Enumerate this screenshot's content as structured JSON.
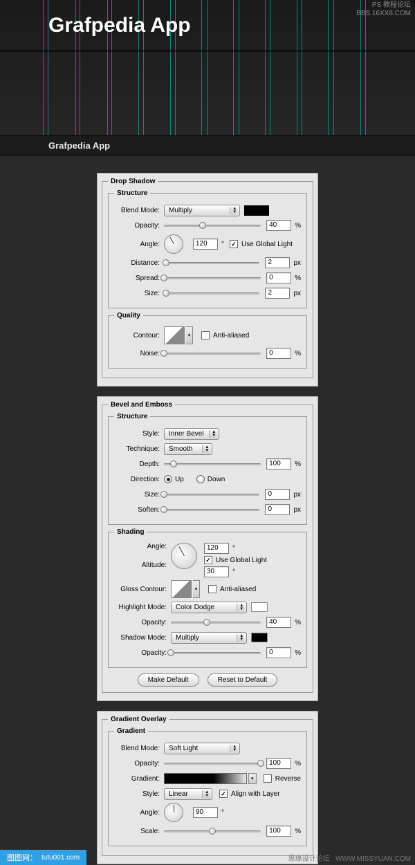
{
  "watermark": {
    "line1": "PS 教程论坛",
    "line2": "BBS.16XX8.COM"
  },
  "app_title": "Grafpedia App",
  "sub_title": "Grafpedia App",
  "guides": [
    62,
    69,
    109,
    115,
    155,
    161,
    200,
    207,
    246,
    253,
    291,
    299,
    337,
    345,
    383,
    390,
    429,
    436,
    474,
    482,
    521,
    528
  ],
  "drop_shadow": {
    "title": "Drop Shadow",
    "structure": {
      "title": "Structure",
      "blend_mode_label": "Blend Mode:",
      "blend_mode": "Multiply",
      "color": "#000000",
      "opacity_label": "Opacity:",
      "opacity": "40",
      "angle_label": "Angle:",
      "angle": "120",
      "use_global_light_label": "Use Global Light",
      "use_global_light": true,
      "distance_label": "Distance:",
      "distance": "2",
      "spread_label": "Spread:",
      "spread": "0",
      "size_label": "Size:",
      "size": "2"
    },
    "quality": {
      "title": "Quality",
      "contour_label": "Contour:",
      "anti_aliased_label": "Anti-aliased",
      "anti_aliased": false,
      "noise_label": "Noise:",
      "noise": "0"
    }
  },
  "bevel": {
    "title": "Bevel and Emboss",
    "structure": {
      "title": "Structure",
      "style_label": "Style:",
      "style": "Inner Bevel",
      "technique_label": "Technique:",
      "technique": "Smooth",
      "depth_label": "Depth:",
      "depth": "100",
      "direction_label": "Direction:",
      "up_label": "Up",
      "down_label": "Down",
      "direction": "up",
      "size_label": "Size:",
      "size": "0",
      "soften_label": "Soften:",
      "soften": "0"
    },
    "shading": {
      "title": "Shading",
      "angle_label": "Angle:",
      "angle": "120",
      "use_global_light_label": "Use Global Light",
      "use_global_light": true,
      "altitude_label": "Altitude:",
      "altitude": "30",
      "gloss_contour_label": "Gloss Contour:",
      "anti_aliased_label": "Anti-aliased",
      "anti_aliased": false,
      "highlight_mode_label": "Highlight Mode:",
      "highlight_mode": "Color Dodge",
      "highlight_color": "#ffffff",
      "highlight_opacity_label": "Opacity:",
      "highlight_opacity": "40",
      "shadow_mode_label": "Shadow Mode:",
      "shadow_mode": "Multiply",
      "shadow_color": "#000000",
      "shadow_opacity_label": "Opacity:",
      "shadow_opacity": "0"
    },
    "make_default": "Make Default",
    "reset_default": "Reset to Default"
  },
  "gradient": {
    "title": "Gradient Overlay",
    "group": {
      "title": "Gradient",
      "blend_mode_label": "Blend Mode:",
      "blend_mode": "Soft Light",
      "opacity_label": "Opacity:",
      "opacity": "100",
      "gradient_label": "Gradient:",
      "reverse_label": "Reverse",
      "reverse": false,
      "style_label": "Style:",
      "style": "Linear",
      "align_label": "Align with Layer",
      "align": true,
      "angle_label": "Angle:",
      "angle": "90",
      "scale_label": "Scale:",
      "scale": "100"
    }
  },
  "units": {
    "pct": "%",
    "px": "px",
    "deg": "°"
  },
  "bottom": {
    "site": "图图网：",
    "url": "tutu001.com",
    "mid": "思缘设计论坛",
    "right": "WWW.MISSYUAN.COM"
  }
}
